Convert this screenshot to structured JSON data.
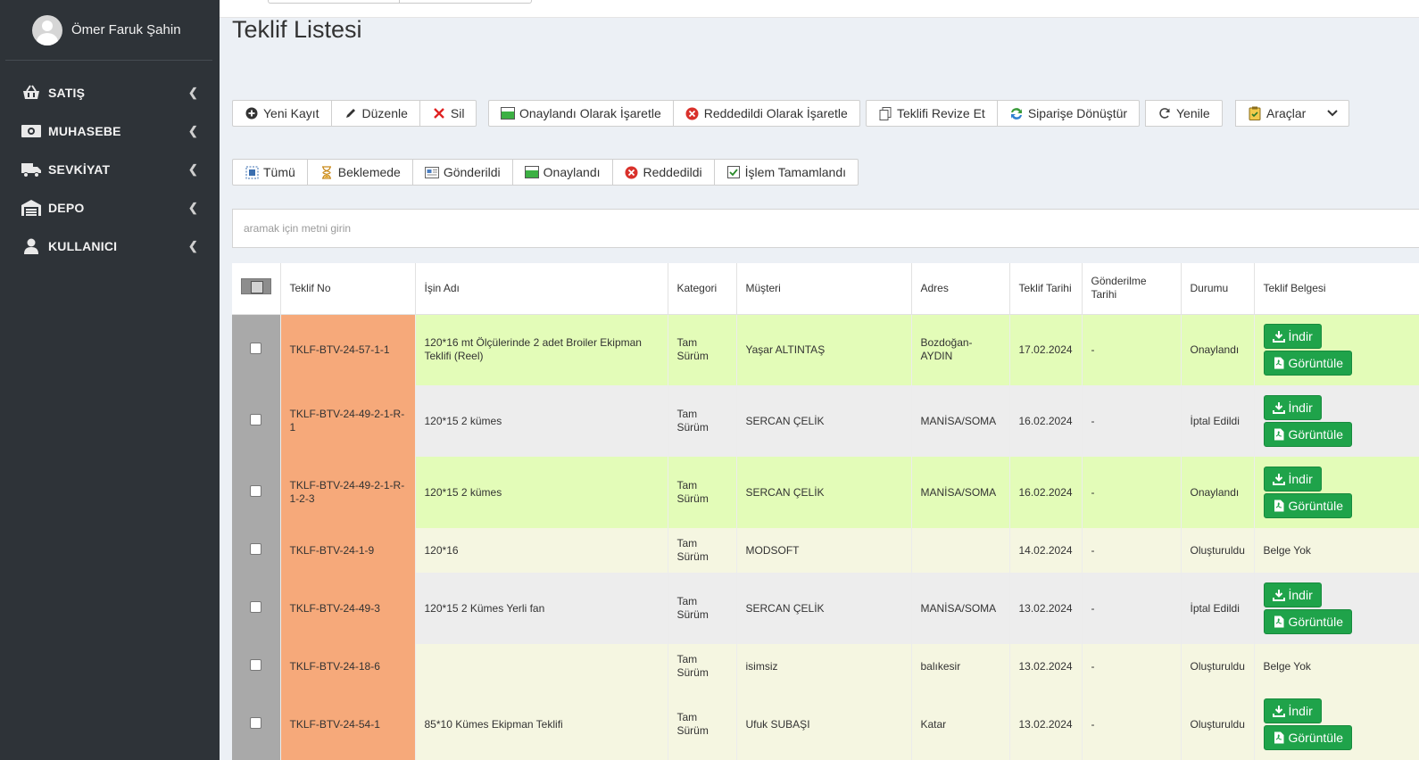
{
  "user": {
    "name": "Ömer Faruk Şahin"
  },
  "sidebar": {
    "items": [
      {
        "label": "SATIŞ",
        "icon": "basket-icon"
      },
      {
        "label": "MUHASEBE",
        "icon": "money-icon"
      },
      {
        "label": "SEVKİYAT",
        "icon": "truck-icon"
      },
      {
        "label": "DEPO",
        "icon": "warehouse-icon"
      },
      {
        "label": "KULLANICI",
        "icon": "user-icon"
      }
    ]
  },
  "page": {
    "title": "Teklif Listesi"
  },
  "toolbar": {
    "new": "Yeni Kayıt",
    "edit": "Düzenle",
    "delete": "Sil",
    "mark_approved": "Onaylandı Olarak İşaretle",
    "mark_rejected": "Reddedildi Olarak İşaretle",
    "revise": "Teklifi Revize Et",
    "convert": "Siparişe Dönüştür",
    "refresh": "Yenile",
    "tools": "Araçlar"
  },
  "filters": {
    "all": "Tümü",
    "pending": "Beklemede",
    "sent": "Gönderildi",
    "approved": "Onaylandı",
    "rejected": "Reddedildi",
    "completed": "İşlem Tamamlandı"
  },
  "search": {
    "placeholder": "aramak için metni girin"
  },
  "table": {
    "headers": {
      "no": "Teklif No",
      "job": "İşin Adı",
      "category": "Kategori",
      "customer": "Müşteri",
      "address": "Adres",
      "date": "Teklif Tarihi",
      "sent_date": "Gönderilme Tarihi",
      "status": "Durumu",
      "document": "Teklif Belgesi"
    },
    "download_label": "İndir",
    "view_label": "Görüntüle",
    "no_doc_label": "Belge Yok",
    "rows": [
      {
        "no": "TKLF-BTV-24-57-1-1",
        "job": "120*16 mt Ölçülerinde 2 adet Broiler Ekipman Teklifi (Reel)",
        "category": "Tam Sürüm",
        "customer": "Yaşar ALTINTAŞ",
        "address": "Bozdoğan-AYDIN",
        "date": "17.02.2024",
        "sent_date": "-",
        "status": "Onaylandı",
        "has_doc": true,
        "color": "green"
      },
      {
        "no": "TKLF-BTV-24-49-2-1-R-1",
        "job": "120*15 2 kümes",
        "category": "Tam Sürüm",
        "customer": "SERCAN ÇELİK",
        "address": "MANİSA/SOMA",
        "date": "16.02.2024",
        "sent_date": "-",
        "status": "İptal Edildi",
        "has_doc": true,
        "color": "gray"
      },
      {
        "no": "TKLF-BTV-24-49-2-1-R-1-2-3",
        "job": "120*15 2 kümes",
        "category": "Tam Sürüm",
        "customer": "SERCAN ÇELİK",
        "address": "MANİSA/SOMA",
        "date": "16.02.2024",
        "sent_date": "-",
        "status": "Onaylandı",
        "has_doc": true,
        "color": "green"
      },
      {
        "no": "TKLF-BTV-24-1-9",
        "job": "120*16",
        "category": "Tam Sürüm",
        "customer": "MODSOFT",
        "address": "",
        "date": "14.02.2024",
        "sent_date": "-",
        "status": "Oluşturuldu",
        "has_doc": false,
        "color": "cream"
      },
      {
        "no": "TKLF-BTV-24-49-3",
        "job": "120*15 2 Kümes Yerli fan",
        "category": "Tam Sürüm",
        "customer": "SERCAN ÇELİK",
        "address": "MANİSA/SOMA",
        "date": "13.02.2024",
        "sent_date": "-",
        "status": "İptal Edildi",
        "has_doc": true,
        "color": "gray"
      },
      {
        "no": "TKLF-BTV-24-18-6",
        "job": "",
        "category": "Tam Sürüm",
        "customer": "isimsiz",
        "address": "balıkesir",
        "date": "13.02.2024",
        "sent_date": "-",
        "status": "Oluşturuldu",
        "has_doc": false,
        "color": "cream"
      },
      {
        "no": "TKLF-BTV-24-54-1",
        "job": "85*10 Kümes Ekipman Teklifi",
        "category": "Tam Sürüm",
        "customer": "Ufuk SUBAŞI",
        "address": "Katar",
        "date": "13.02.2024",
        "sent_date": "-",
        "status": "Oluşturuldu",
        "has_doc": true,
        "color": "cream"
      }
    ]
  }
}
